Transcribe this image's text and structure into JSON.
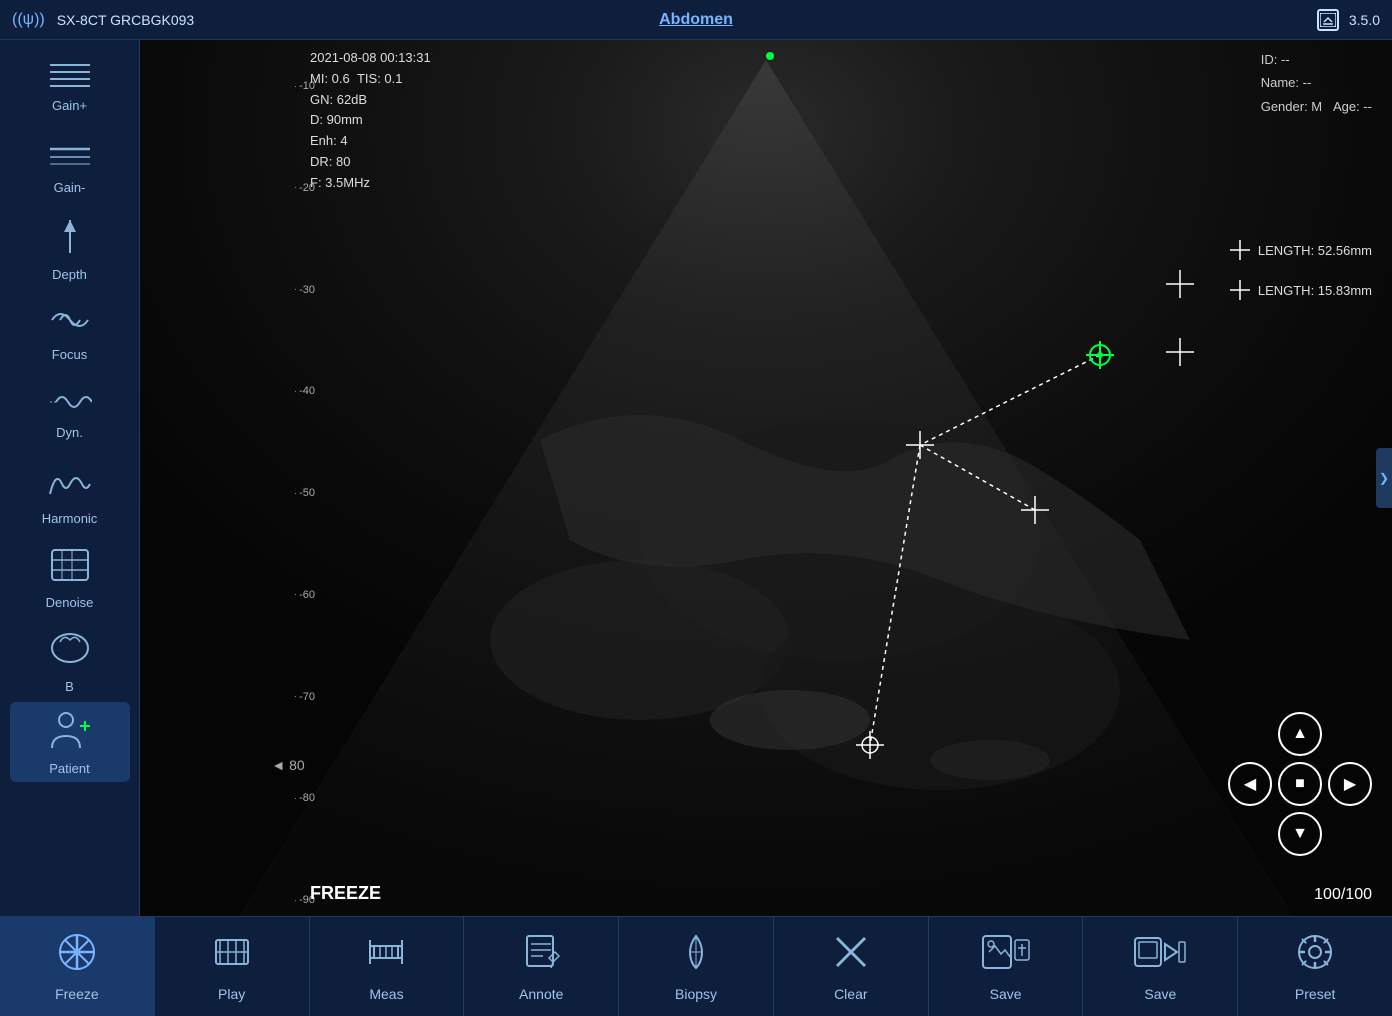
{
  "topbar": {
    "device": "SX-8CT GRCBGK093",
    "exam": "Abdomen",
    "version": "3.5.0"
  },
  "info": {
    "datetime": "2021-08-08 00:13:31",
    "mi": "MI: 0.6",
    "tis": "TIS: 0.1",
    "gn": "GN: 62dB",
    "depth": "D: 90mm",
    "enh": "Enh: 4",
    "dr": "DR: 80",
    "freq": "F: 3.5MHz"
  },
  "patient": {
    "id": "ID: --",
    "name": "Name: --",
    "gender": "Gender: M",
    "age": "Age: --"
  },
  "measurements": [
    {
      "label": "LENGTH: 52.56mm"
    },
    {
      "label": "LENGTH: 15.83mm"
    }
  ],
  "status": {
    "freeze": "FREEZE",
    "frame": "100/100"
  },
  "sidebar": {
    "items": [
      {
        "id": "gain-plus",
        "label": "Gain+",
        "icon": "≋"
      },
      {
        "id": "gain-minus",
        "label": "Gain-",
        "icon": "≋"
      },
      {
        "id": "depth",
        "label": "Depth",
        "icon": "⬆"
      },
      {
        "id": "focus",
        "label": "Focus",
        "icon": "⦿"
      },
      {
        "id": "dyn",
        "label": "Dyn.",
        "icon": "∿"
      },
      {
        "id": "harmonic",
        "label": "Harmonic",
        "icon": "∿"
      },
      {
        "id": "denoise",
        "label": "Denoise",
        "icon": "▭"
      },
      {
        "id": "b-mode",
        "label": "B",
        "icon": "◎"
      },
      {
        "id": "patient",
        "label": "Patient",
        "icon": "👤"
      }
    ]
  },
  "toolbar": {
    "buttons": [
      {
        "id": "freeze",
        "label": "Freeze",
        "icon": "freeze"
      },
      {
        "id": "play",
        "label": "Play",
        "icon": "play"
      },
      {
        "id": "meas",
        "label": "Meas",
        "icon": "meas"
      },
      {
        "id": "annote",
        "label": "Annote",
        "icon": "annote"
      },
      {
        "id": "biopsy",
        "label": "Biopsy",
        "icon": "biopsy"
      },
      {
        "id": "clear",
        "label": "Clear",
        "icon": "clear"
      },
      {
        "id": "save1",
        "label": "Save",
        "icon": "save1"
      },
      {
        "id": "save2",
        "label": "Save",
        "icon": "save2"
      },
      {
        "id": "preset",
        "label": "Preset",
        "icon": "preset"
      }
    ]
  },
  "depth_marks": [
    {
      "value": "-10"
    },
    {
      "value": "-20"
    },
    {
      "value": "-30"
    },
    {
      "value": "-40"
    },
    {
      "value": "-50"
    },
    {
      "value": "-60"
    },
    {
      "value": "-70"
    },
    {
      "value": "-80"
    },
    {
      "value": "-90"
    }
  ]
}
